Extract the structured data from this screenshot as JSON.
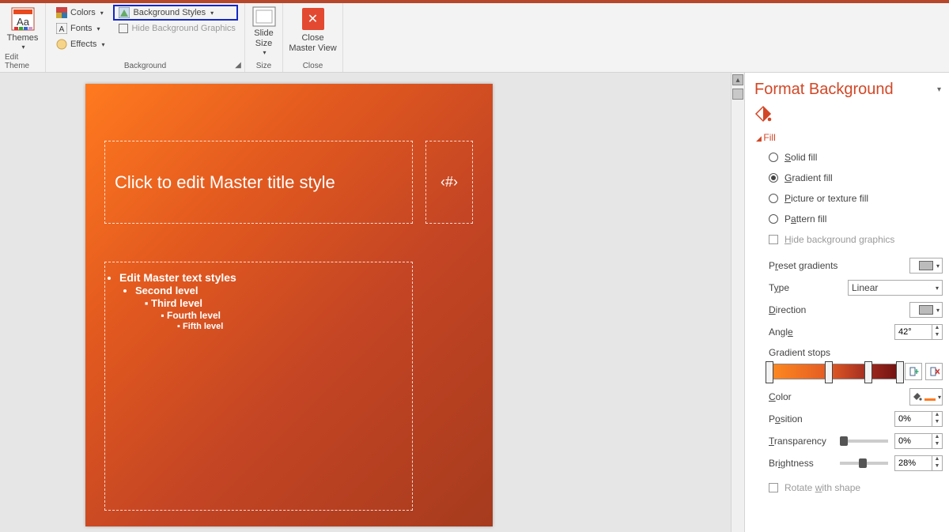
{
  "ribbon": {
    "edit_theme": {
      "themes": "Themes",
      "label": "Edit Theme"
    },
    "background": {
      "colors": "Colors",
      "fonts": "Fonts",
      "effects": "Effects",
      "bg_styles": "Background Styles",
      "hide_bg_graphics": "Hide Background Graphics",
      "label": "Background"
    },
    "size": {
      "slide_size_l1": "Slide",
      "slide_size_l2": "Size",
      "label": "Size"
    },
    "close": {
      "l1": "Close",
      "l2": "Master View",
      "label": "Close"
    }
  },
  "slide": {
    "title_ph": "Click to edit Master title style",
    "num_ph": "‹#›",
    "b1": "Edit Master text styles",
    "b2": "Second level",
    "b3": "Third level",
    "b4": "Fourth level",
    "b5": "Fifth level"
  },
  "pane": {
    "title": "Format Background",
    "section": "Fill",
    "solid_fill": "Solid fill",
    "gradient_fill": "Gradient fill",
    "pic_fill": "Picture or texture fill",
    "pattern_fill": "Pattern fill",
    "hide_bg": "Hide background graphics",
    "preset_grad": "Preset gradients",
    "type_lbl": "Type",
    "type_val": "Linear",
    "direction": "Direction",
    "angle_lbl": "Angle",
    "angle_val": "42°",
    "grad_stops": "Gradient stops",
    "color_lbl": "Color",
    "position_lbl": "Position",
    "position_val": "0%",
    "transparency_lbl": "Transparency",
    "transparency_val": "0%",
    "brightness_lbl": "Brightness",
    "brightness_val": "28%",
    "rotate": "Rotate with shape",
    "stops": [
      0,
      45,
      75,
      100
    ],
    "transparency_slider": 0,
    "brightness_slider": 40
  }
}
